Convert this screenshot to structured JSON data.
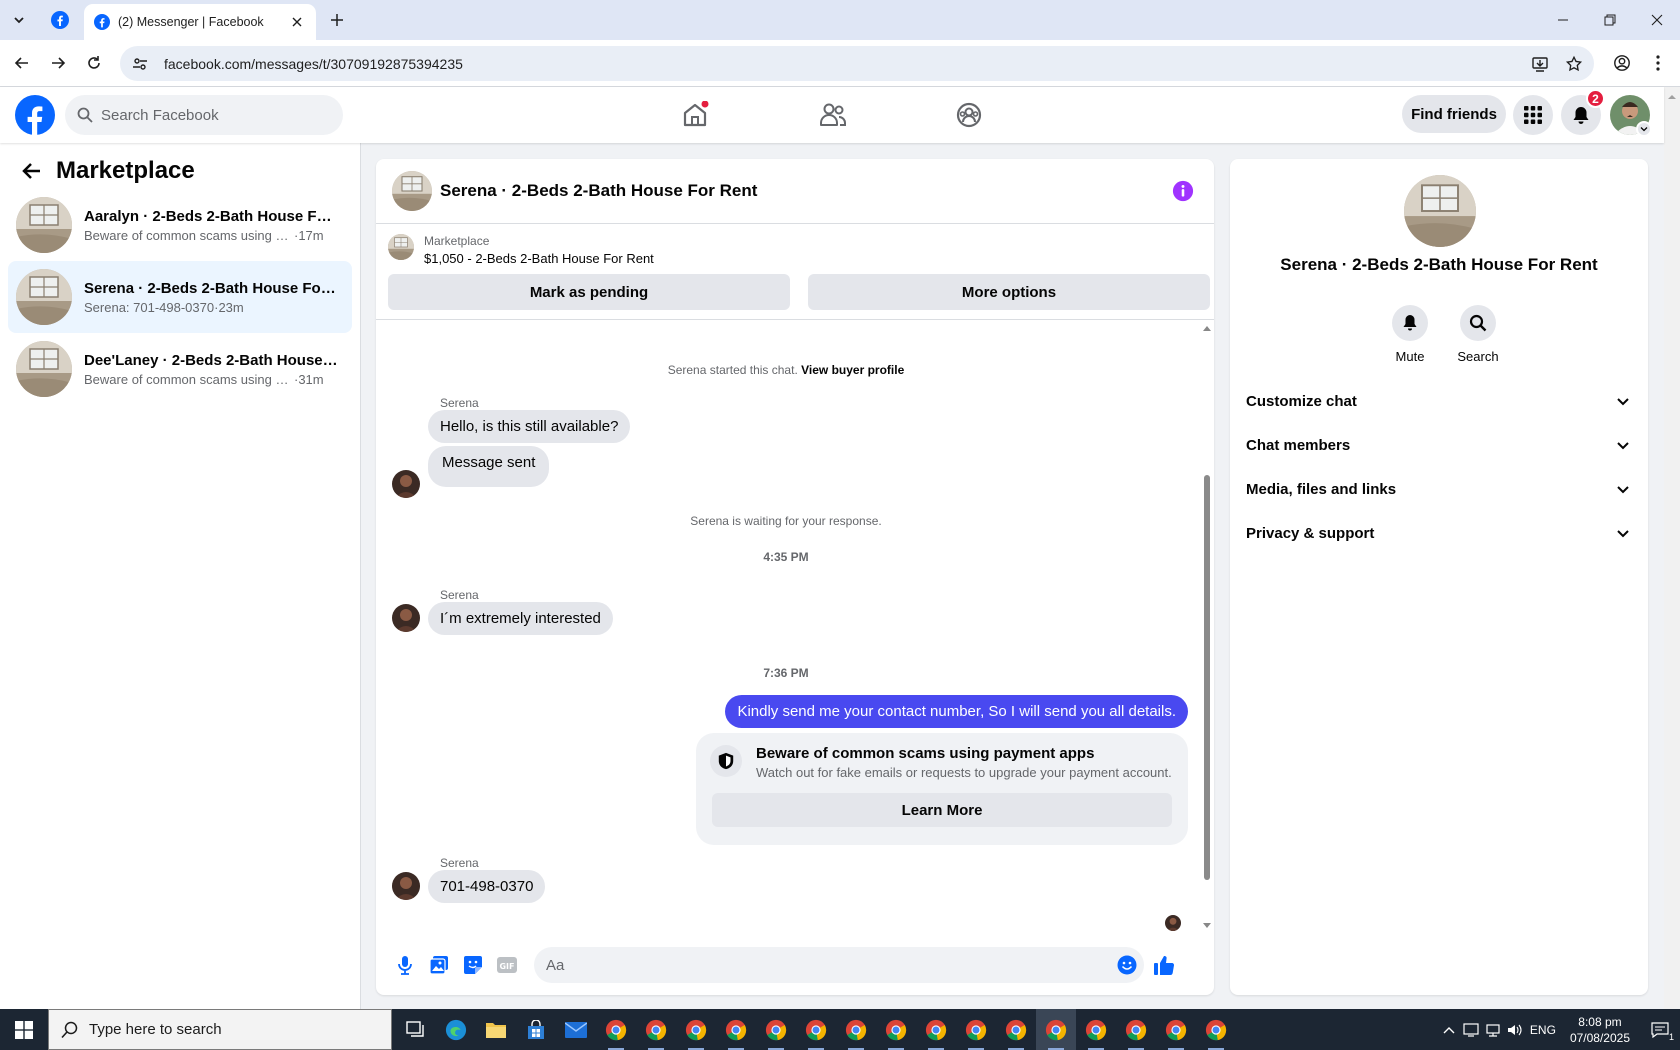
{
  "browser": {
    "tab_title": "(2) Messenger | Facebook",
    "url": "facebook.com/messages/t/30709192875394235"
  },
  "fb_header": {
    "search_placeholder": "Search Facebook",
    "find_friends": "Find friends",
    "notification_count": "2"
  },
  "sidebar": {
    "title": "Marketplace",
    "conversations": [
      {
        "name": "Aaralyn · 2-Beds 2-Bath House For...",
        "preview": "Beware of common scams using pa...",
        "time": "·17m"
      },
      {
        "name": "Serena · 2-Beds 2-Bath House For ...",
        "preview": "Serena: 701-498-0370",
        "time": "·23m"
      },
      {
        "name": "Dee'Laney · 2-Beds 2-Bath House ...",
        "preview": "Beware of common scams using pa...",
        "time": "·31m"
      }
    ]
  },
  "chat": {
    "title": "Serena · 2-Beds 2-Bath House For Rent",
    "listing_source": "Marketplace",
    "listing_price": "$1,050 - 2-Beds 2-Bath House For Rent",
    "mark_pending": "Mark as pending",
    "more_options": "More options",
    "started_note": "Serena started this chat.",
    "view_profile": "View buyer profile",
    "sender": "Serena",
    "msg1": "Hello, is this still available?",
    "msg2": "Message sent",
    "waiting_note": "Serena is waiting for your response.",
    "time1": "4:35 PM",
    "msg3": "I´m extremely interested",
    "time2": "7:36 PM",
    "msg_out": "Kindly send me your contact number, So I will send you all details.",
    "scam_title": "Beware of common scams using payment apps",
    "scam_desc": "Watch out for fake emails or requests to upgrade your payment account.",
    "learn_more": "Learn More",
    "msg4": "701-498-0370",
    "composer_placeholder": "Aa"
  },
  "info_panel": {
    "name": "Serena · 2-Beds 2-Bath House For Rent",
    "mute": "Mute",
    "search": "Search",
    "sections": [
      "Customize chat",
      "Chat members",
      "Media, files and links",
      "Privacy & support"
    ]
  },
  "taskbar": {
    "search_placeholder": "Type here to search",
    "lang": "ENG",
    "time": "8:08 pm",
    "date": "07/08/2025",
    "notif_count": "1"
  },
  "colors": {
    "fb_blue": "#0866ff",
    "outgoing_bubble": "#4949f0",
    "info_purple": "#a033ff",
    "badge_red": "#e41e3f"
  },
  "icons": [
    "home-icon",
    "friends-icon",
    "groups-icon",
    "apps-grid-icon",
    "bell-icon",
    "mic-icon",
    "photo-icon",
    "sticker-icon",
    "gif-icon",
    "emoji-icon",
    "thumbs-up-icon",
    "shield-icon",
    "chevron-down-icon"
  ]
}
